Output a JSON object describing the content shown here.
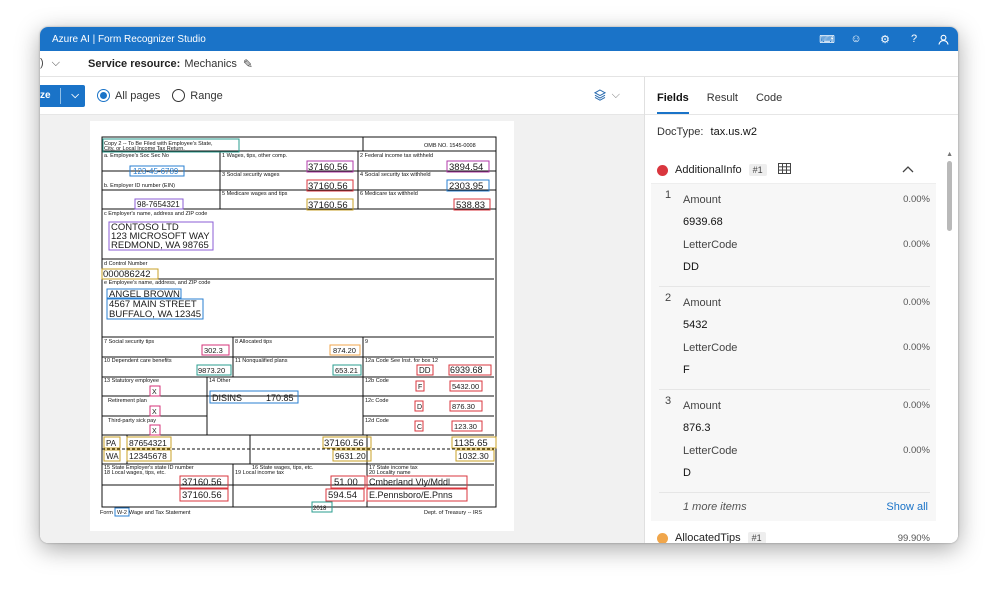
{
  "app": {
    "title": "Azure AI | Form Recognizer Studio"
  },
  "header": {
    "service_label": "Service resource:",
    "service_value": "Mechanics",
    "left_fragment": ")"
  },
  "toolbar": {
    "analyze_label": "ze",
    "all_pages": "All pages",
    "range": "Range"
  },
  "tabs": [
    "Fields",
    "Result",
    "Code"
  ],
  "doctype": {
    "label": "DocType:",
    "value": "tax.us.w2"
  },
  "fields": {
    "additional": {
      "name": "AdditionalInfo",
      "badge": "#1",
      "color": "#d9363e",
      "items": [
        {
          "idx": "1",
          "k1": "Amount",
          "p1": "0.00%",
          "v1": "6939.68",
          "k2": "LetterCode",
          "p2": "0.00%",
          "v2": "DD"
        },
        {
          "idx": "2",
          "k1": "Amount",
          "p1": "0.00%",
          "v1": "5432",
          "k2": "LetterCode",
          "p2": "0.00%",
          "v2": "F"
        },
        {
          "idx": "3",
          "k1": "Amount",
          "p1": "0.00%",
          "v1": "876.3",
          "k2": "LetterCode",
          "p2": "0.00%",
          "v2": "D"
        }
      ],
      "more_items": "1 more items",
      "show_all": "Show all"
    },
    "allocated": {
      "name": "AllocatedTips",
      "badge": "#1",
      "pct": "99.90%",
      "color": "#f0a64b"
    }
  },
  "w2": {
    "copy_line1": "Copy 2 -- To Be Filed with Employee's State,",
    "copy_line2": "City, or Local Income Tax Return.",
    "omb": "OMB NO. 1545-0008",
    "a_label": "a. Employee's Soc Sec No",
    "ssn": "123-45-6789",
    "b1_label": "1 Wages, tips, other comp.",
    "b1": "37160.56",
    "b2_label": "2 Federal income tax withheld",
    "b2": "3894.54",
    "b3_label": "3 Social security wages",
    "b3": "37160.56",
    "b4_label": "4 Social security tax withheld",
    "b4": "2303.95",
    "b_label": "b. Employer ID number (EIN)",
    "ein": "98-7654321",
    "b5_label": "5 Medicare wages and tips",
    "b5": "37160.56",
    "b6_label": "6 Medicare tax withheld",
    "b6": "538.83",
    "c_label": "c Employer's name, address and ZIP code",
    "emp1": "CONTOSO LTD",
    "emp2": "123 MICROSOFT WAY",
    "emp3": "REDMOND, WA 98765",
    "d_label": "d Control Number",
    "ctrl": "000086242",
    "e_label": "e Employee's name, address, and ZIP code",
    "ee1": "ANGEL BROWN",
    "ee2": "4567 MAIN STREET",
    "ee3": "BUFFALO, WA 12345",
    "b7_label": "7 Social security tips",
    "b7": "302.3",
    "b8_label": "8 Allocated tips",
    "b8": "874.20",
    "b9_label": "9",
    "b10_label": "10 Dependent care benefits",
    "b10": "9873.20",
    "b11_label": "11 Nonqualified plans",
    "b11": "653.21",
    "b12a_label": "12a Code See Inst. for box 12",
    "b12a_code": "DD",
    "b12a": "6939.68",
    "b13_label": "13 Statutory employee",
    "b14_label": "14 Other",
    "b14_code": "DISINS",
    "b14": "170.85",
    "b12b_label": "12b Code",
    "b12b_code": "F",
    "b12b": "5432.00",
    "ret_label": "Retirement plan",
    "b12c_label": "12c Code",
    "b12c_code": "D",
    "b12c": "876.30",
    "tp_label": "Third-party sick pay",
    "b12d_label": "12d Code",
    "b12d_code": "C",
    "b12d": "123.30",
    "x": "X",
    "st1": "PA",
    "st1_id": "87654321",
    "st1_wages": "37160.56",
    "st1_tax": "1135.65",
    "st2": "WA",
    "st2_id": "12345678",
    "st2_wages": "9631.20",
    "st2_tax": "1032.30",
    "b15_label": "15 State Employer's state ID number",
    "b16_label": "16 State wages, tips, etc.",
    "b17_label": "17 State income tax",
    "b18_label": "18 Local wages, tips, etc.",
    "b19_label": "19 Local income tax",
    "b20_label": "20 Locality name",
    "l18a": "37160.56",
    "l18b": "37160.56",
    "l19a": "51.00",
    "l19b": "594.54",
    "l20a": "Cmberland Vly/Mddl",
    "l20b": "E.Pennsboro/E.Pnns",
    "form_label": "Form",
    "form_w2": "W-2",
    "form_tail": "Wage and Tax Statement",
    "year": "2018",
    "dept": "Dept. of Treasury -- IRS"
  }
}
